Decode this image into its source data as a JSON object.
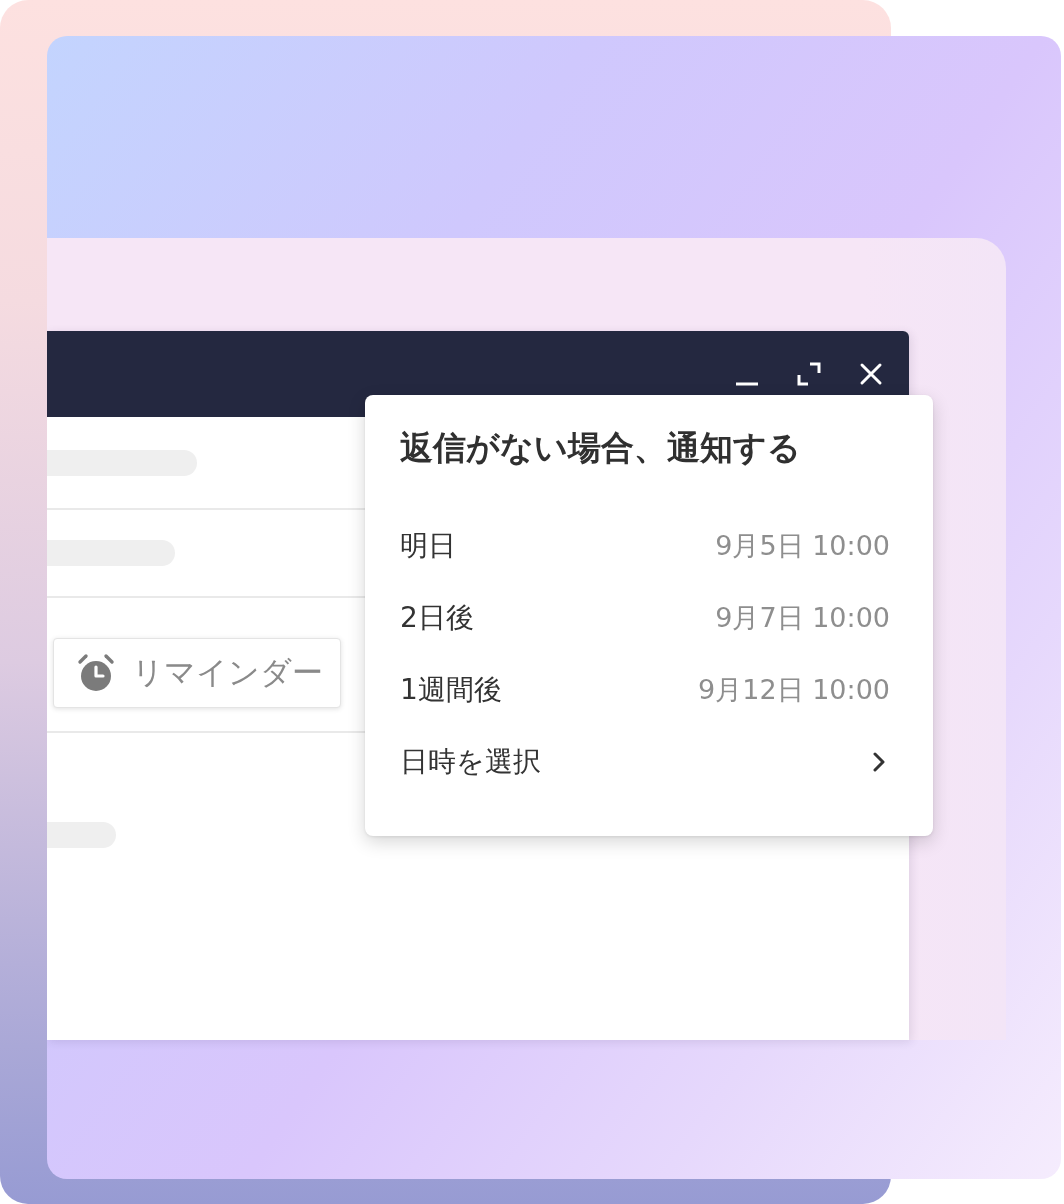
{
  "compose_window": {
    "reminder_button": {
      "label": "リマインダー"
    }
  },
  "reminder_menu": {
    "title": "返信がない場合、通知する",
    "options": [
      {
        "kind": "preset",
        "label": "明日",
        "time": "9月5日 10:00"
      },
      {
        "kind": "preset",
        "label": "2日後",
        "time": "9月7日 10:00"
      },
      {
        "kind": "preset",
        "label": "1週間後",
        "time": "9月12日 10:00"
      },
      {
        "kind": "submenu",
        "label": "日時を選択"
      }
    ]
  }
}
